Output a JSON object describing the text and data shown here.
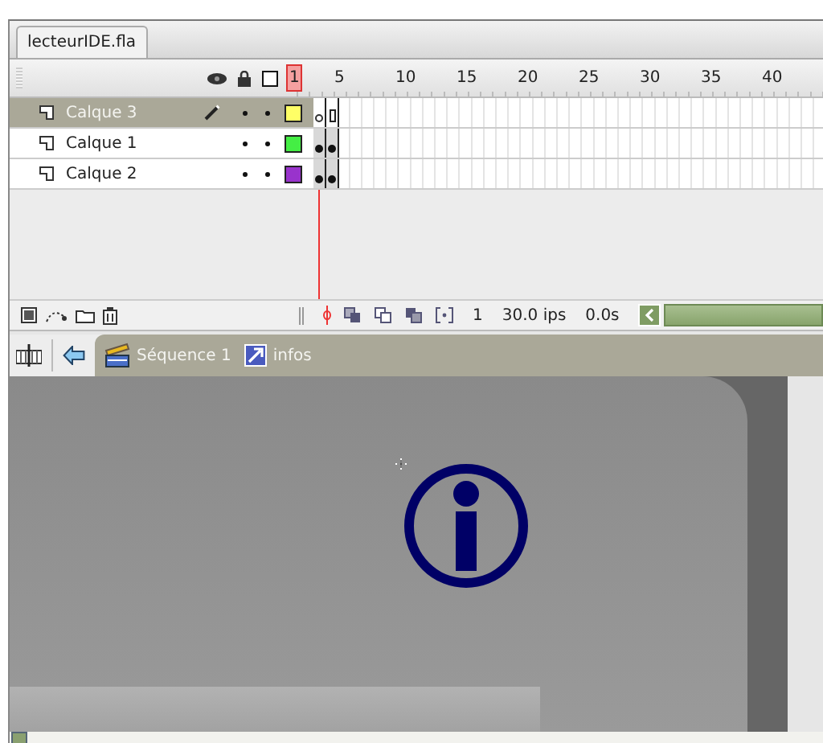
{
  "document_tab": {
    "title": "lecteurIDE.fla",
    "selected": true
  },
  "frame_labels": [
    "1",
    "5",
    "10",
    "15",
    "20",
    "25",
    "30",
    "35",
    "40"
  ],
  "layers": [
    {
      "name": "Calque 3",
      "selected": true,
      "editing": true,
      "visible": true,
      "locked": false,
      "color": "#ffff66",
      "frames": [
        {
          "keyframe": true,
          "content": false
        },
        {
          "keyframe": false,
          "content": false
        }
      ]
    },
    {
      "name": "Calque 1",
      "selected": false,
      "editing": false,
      "visible": true,
      "locked": false,
      "color": "#44ee44",
      "frames": [
        {
          "keyframe": true,
          "content": true
        },
        {
          "keyframe": true,
          "content": true
        }
      ]
    },
    {
      "name": "Calque 2",
      "selected": false,
      "editing": false,
      "visible": true,
      "locked": false,
      "color": "#9933cc",
      "frames": [
        {
          "keyframe": true,
          "content": true
        },
        {
          "keyframe": true,
          "content": true
        }
      ]
    }
  ],
  "status": {
    "current_frame": "1",
    "frame_rate": "30.0 ips",
    "elapsed": "0.0s"
  },
  "breadcrumbs": [
    {
      "kind": "scene",
      "label": "Séquence 1"
    },
    {
      "kind": "symbol",
      "label": "infos"
    }
  ]
}
